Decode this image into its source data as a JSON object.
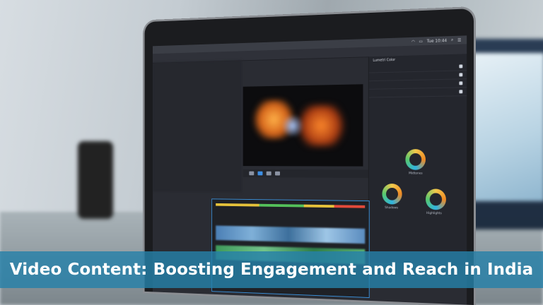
{
  "caption": {
    "text": "Video Content: Boosting Engagement and Reach in India"
  },
  "colors": {
    "banner": "#2680a8",
    "caption_text": "#ffffff",
    "laptop_bezel": "#1b1c1f",
    "editor_background": "#2a2c33"
  },
  "menubar": {
    "time": "Tue 10:44"
  },
  "color_panel": {
    "title": "Lumetri Color",
    "wheels": [
      "Shadows",
      "Midtones",
      "Highlights"
    ]
  }
}
